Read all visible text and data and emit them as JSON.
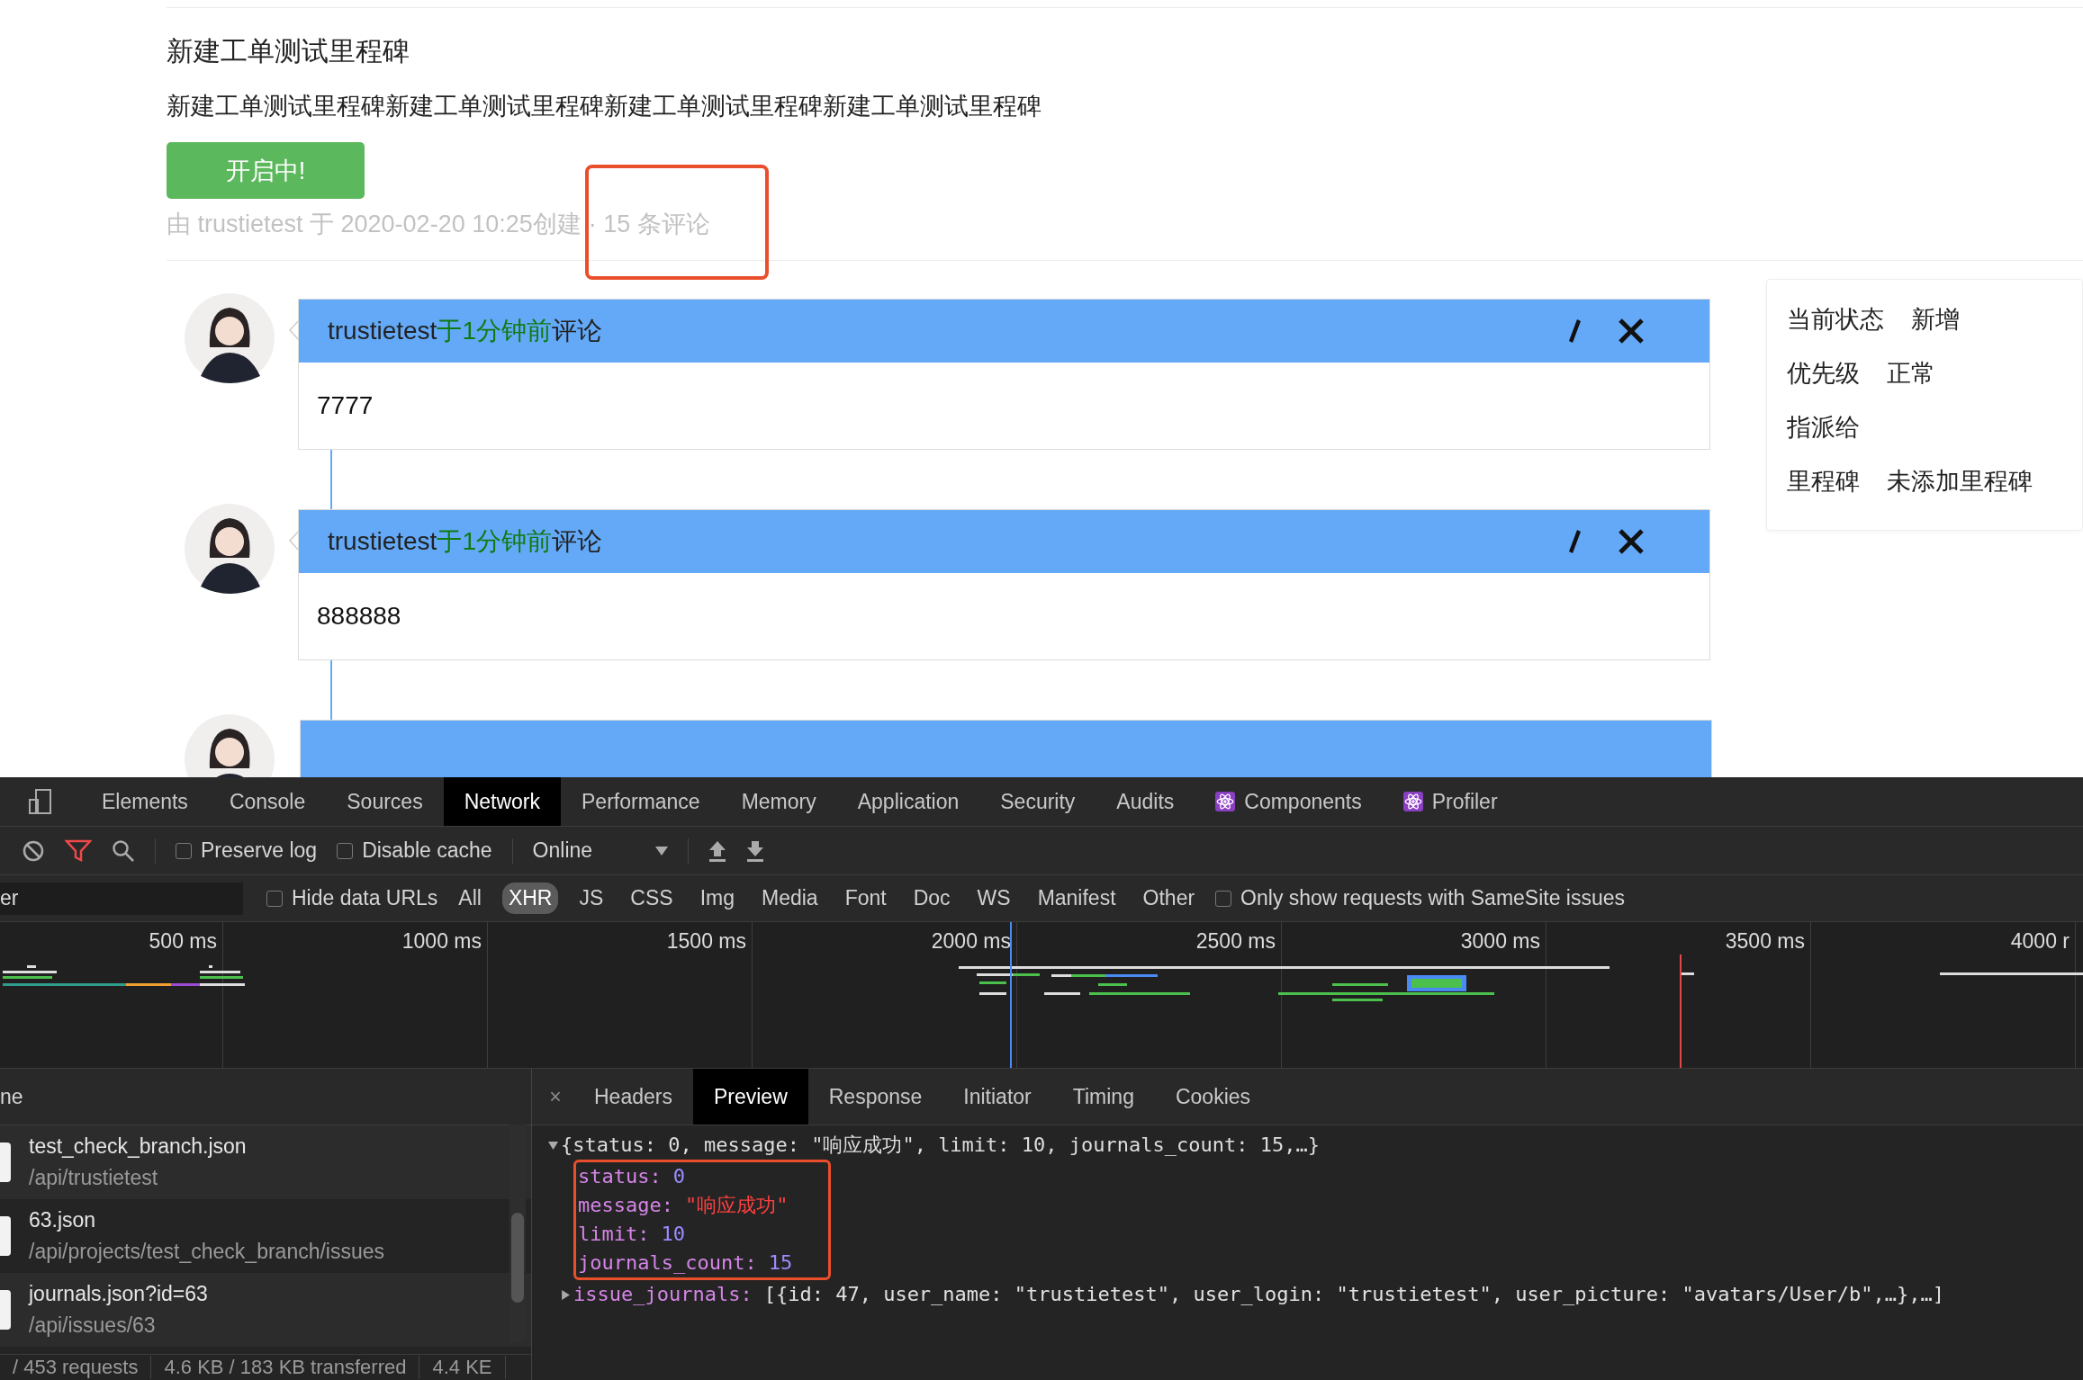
{
  "issue": {
    "title": "新建工单测试里程碑",
    "description": "新建工单测试里程碑新建工单测试里程碑新建工单测试里程碑新建工单测试里程碑",
    "status_button": "开启中!",
    "meta": "由 trustietest 于 2020-02-20 10:25创建",
    "comment_count": {
      "text": "· 15 条评论",
      "highlighted": true
    }
  },
  "comments": [
    {
      "kind": "full",
      "user": "trustietest",
      "time": "于1分钟前",
      "action": "评论",
      "body": "7777"
    },
    {
      "kind": "full",
      "user": "trustietest",
      "time": "于1分钟前",
      "action": "评论",
      "body": "888888"
    },
    {
      "kind": "cut"
    }
  ],
  "side_panel": [
    {
      "label": "当前状态",
      "value": "新增"
    },
    {
      "label": "优先级",
      "value": "正常"
    },
    {
      "label": "指派给"
    },
    {
      "label": "里程碑",
      "value": "未添加里程碑"
    }
  ],
  "devtools": {
    "tabs": [
      {
        "label": "Elements",
        "selected": false
      },
      {
        "label": "Console",
        "selected": false
      },
      {
        "label": "Sources",
        "selected": false
      },
      {
        "label": "Network",
        "selected": true
      },
      {
        "label": "Performance",
        "selected": false
      },
      {
        "label": "Memory",
        "selected": false
      },
      {
        "label": "Application",
        "selected": false
      },
      {
        "label": "Security",
        "selected": false
      },
      {
        "label": "Audits",
        "selected": false
      },
      {
        "label": "Components",
        "selected": false,
        "kind": "react"
      },
      {
        "label": "Profiler",
        "selected": false,
        "kind": "react"
      }
    ],
    "toolbar": {
      "filter_active": true,
      "preserve_log": {
        "label": "Preserve log",
        "checked": false
      },
      "disable_cache": {
        "label": "Disable cache",
        "checked": false
      },
      "throttling": "Online"
    },
    "filter_bar": {
      "filter_value": "er",
      "hide_data_urls": {
        "label": "Hide data URLs",
        "checked": false
      },
      "types": [
        {
          "label": "All",
          "selected": false
        },
        {
          "label": "XHR",
          "selected": true
        },
        {
          "label": "JS",
          "selected": false
        },
        {
          "label": "CSS",
          "selected": false
        },
        {
          "label": "Img",
          "selected": false
        },
        {
          "label": "Media",
          "selected": false
        },
        {
          "label": "Font",
          "selected": false
        },
        {
          "label": "Doc",
          "selected": false
        },
        {
          "label": "WS",
          "selected": false
        },
        {
          "label": "Manifest",
          "selected": false
        },
        {
          "label": "Other",
          "selected": false
        }
      ],
      "samesite": {
        "label": "Only show requests with SameSite issues",
        "checked": false
      }
    },
    "timeline_ticks": [
      "500 ms",
      "1000 ms",
      "1500 ms",
      "2000 ms",
      "2500 ms",
      "3000 ms",
      "3500 ms",
      "4000 r"
    ],
    "requests_header": "ne",
    "requests": [
      {
        "name": "test_check_branch.json",
        "path": "/api/trustietest"
      },
      {
        "name": "63.json",
        "path": "/api/projects/test_check_branch/issues"
      },
      {
        "name": "journals.json?id=63",
        "path": "/api/issues/63"
      }
    ],
    "summary": [
      "/ 453 requests",
      "4.6 KB / 183 KB transferred",
      "4.4 KE"
    ],
    "detail_close": "×",
    "detail_tabs": [
      {
        "label": "Headers",
        "selected": false
      },
      {
        "label": "Preview",
        "selected": true
      },
      {
        "label": "Response",
        "selected": false
      },
      {
        "label": "Initiator",
        "selected": false
      },
      {
        "label": "Timing",
        "selected": false
      },
      {
        "label": "Cookies",
        "selected": false
      }
    ],
    "preview": {
      "expanded": true,
      "summary": "{status: 0, message: \"响应成功\", limit: 10, journals_count: 15,…}",
      "properties": [
        {
          "key": "status:",
          "value": "0",
          "kind": "number",
          "highlighted": true
        },
        {
          "key": "message:",
          "value": "\"响应成功\"",
          "kind": "string",
          "highlighted": true
        },
        {
          "key": "limit:",
          "value": "10",
          "kind": "number",
          "highlighted": true
        },
        {
          "key": "journals_count:",
          "value": "15",
          "kind": "number",
          "highlighted": true
        },
        {
          "key": "issue_journals:",
          "value": "[{id: 47, user_name: \"trustietest\", user_login: \"trustietest\", user_picture: \"avatars/User/b\",…},…]",
          "kind": "object",
          "expanded": false
        }
      ]
    }
  }
}
